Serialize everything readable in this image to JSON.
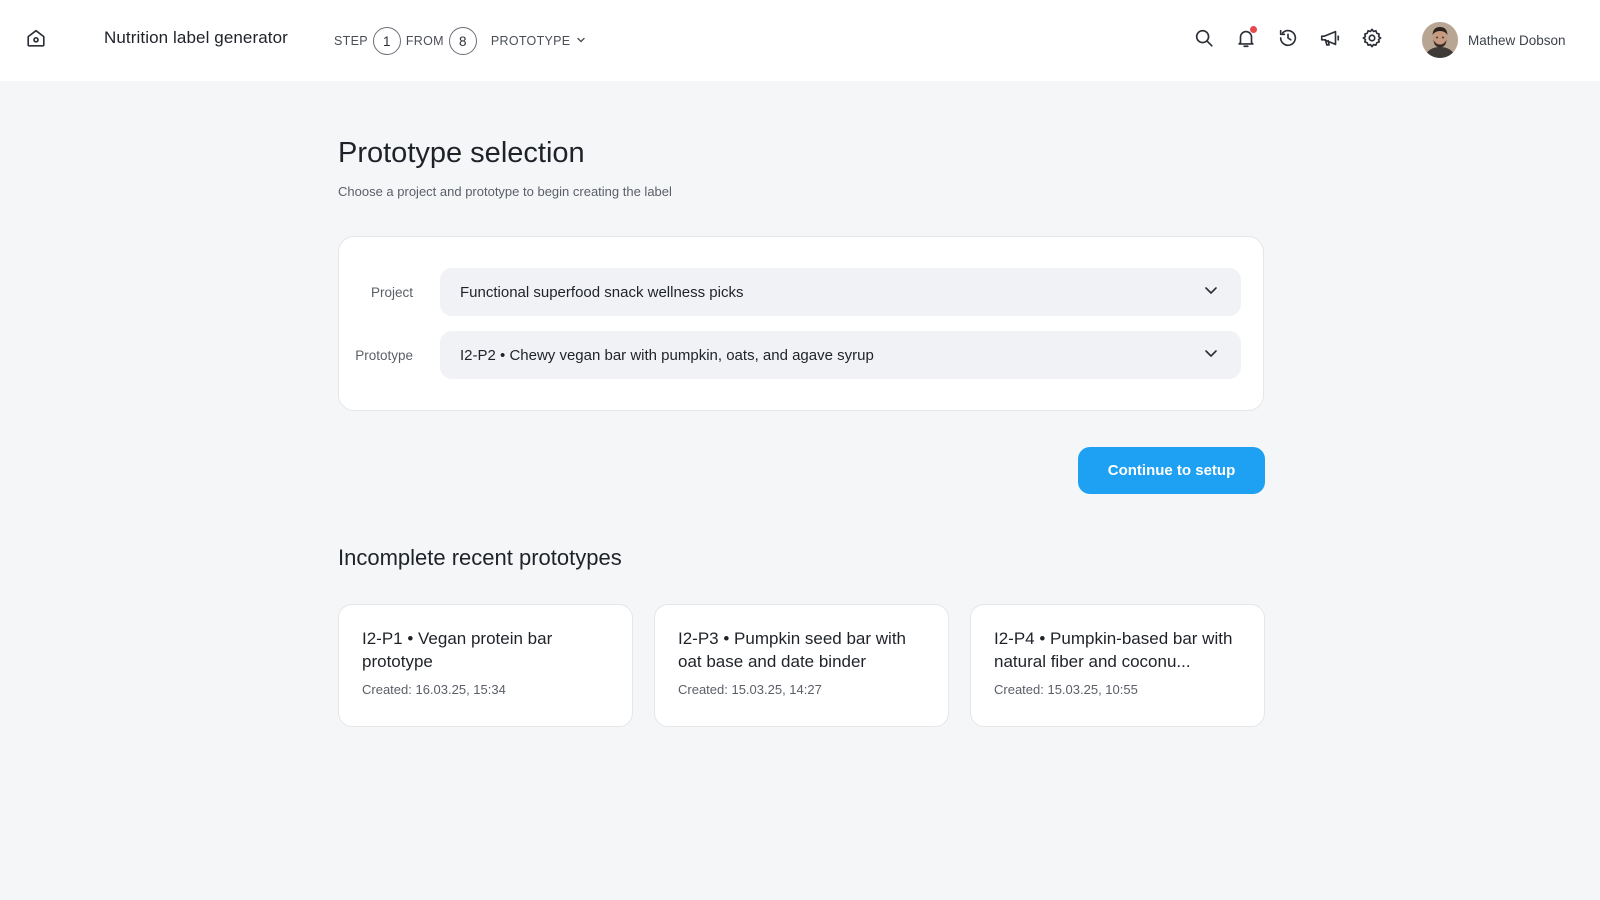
{
  "header": {
    "app_title": "Nutrition label generator",
    "step_prefix": "STEP",
    "step_current": "1",
    "step_from": "FROM",
    "step_total": "8",
    "stage_label": "PROTOTYPE",
    "user_name": "Mathew Dobson",
    "notification_dot_color": "#e5484d"
  },
  "main": {
    "title": "Prototype selection",
    "subtitle": "Choose a project and prototype to begin creating the label",
    "project_label": "Project",
    "project_value": "Functional superfood snack wellness picks",
    "prototype_label": "Prototype",
    "prototype_value": "I2-P2 • Chewy vegan bar with pumpkin, oats, and agave syrup",
    "continue_label": "Continue to setup",
    "accent_color": "#1ea1f2"
  },
  "recent": {
    "title": "Incomplete recent prototypes",
    "items": [
      {
        "name": "I2-P1 • Vegan protein bar prototype",
        "created": "Created: 16.03.25, 15:34"
      },
      {
        "name": "I2-P3 • Pumpkin seed bar with oat base and date binder",
        "created": "Created: 15.03.25, 14:27"
      },
      {
        "name": "I2-P4 • Pumpkin-based bar with natural fiber and coconu...",
        "created": "Created: 15.03.25, 10:55"
      }
    ]
  }
}
